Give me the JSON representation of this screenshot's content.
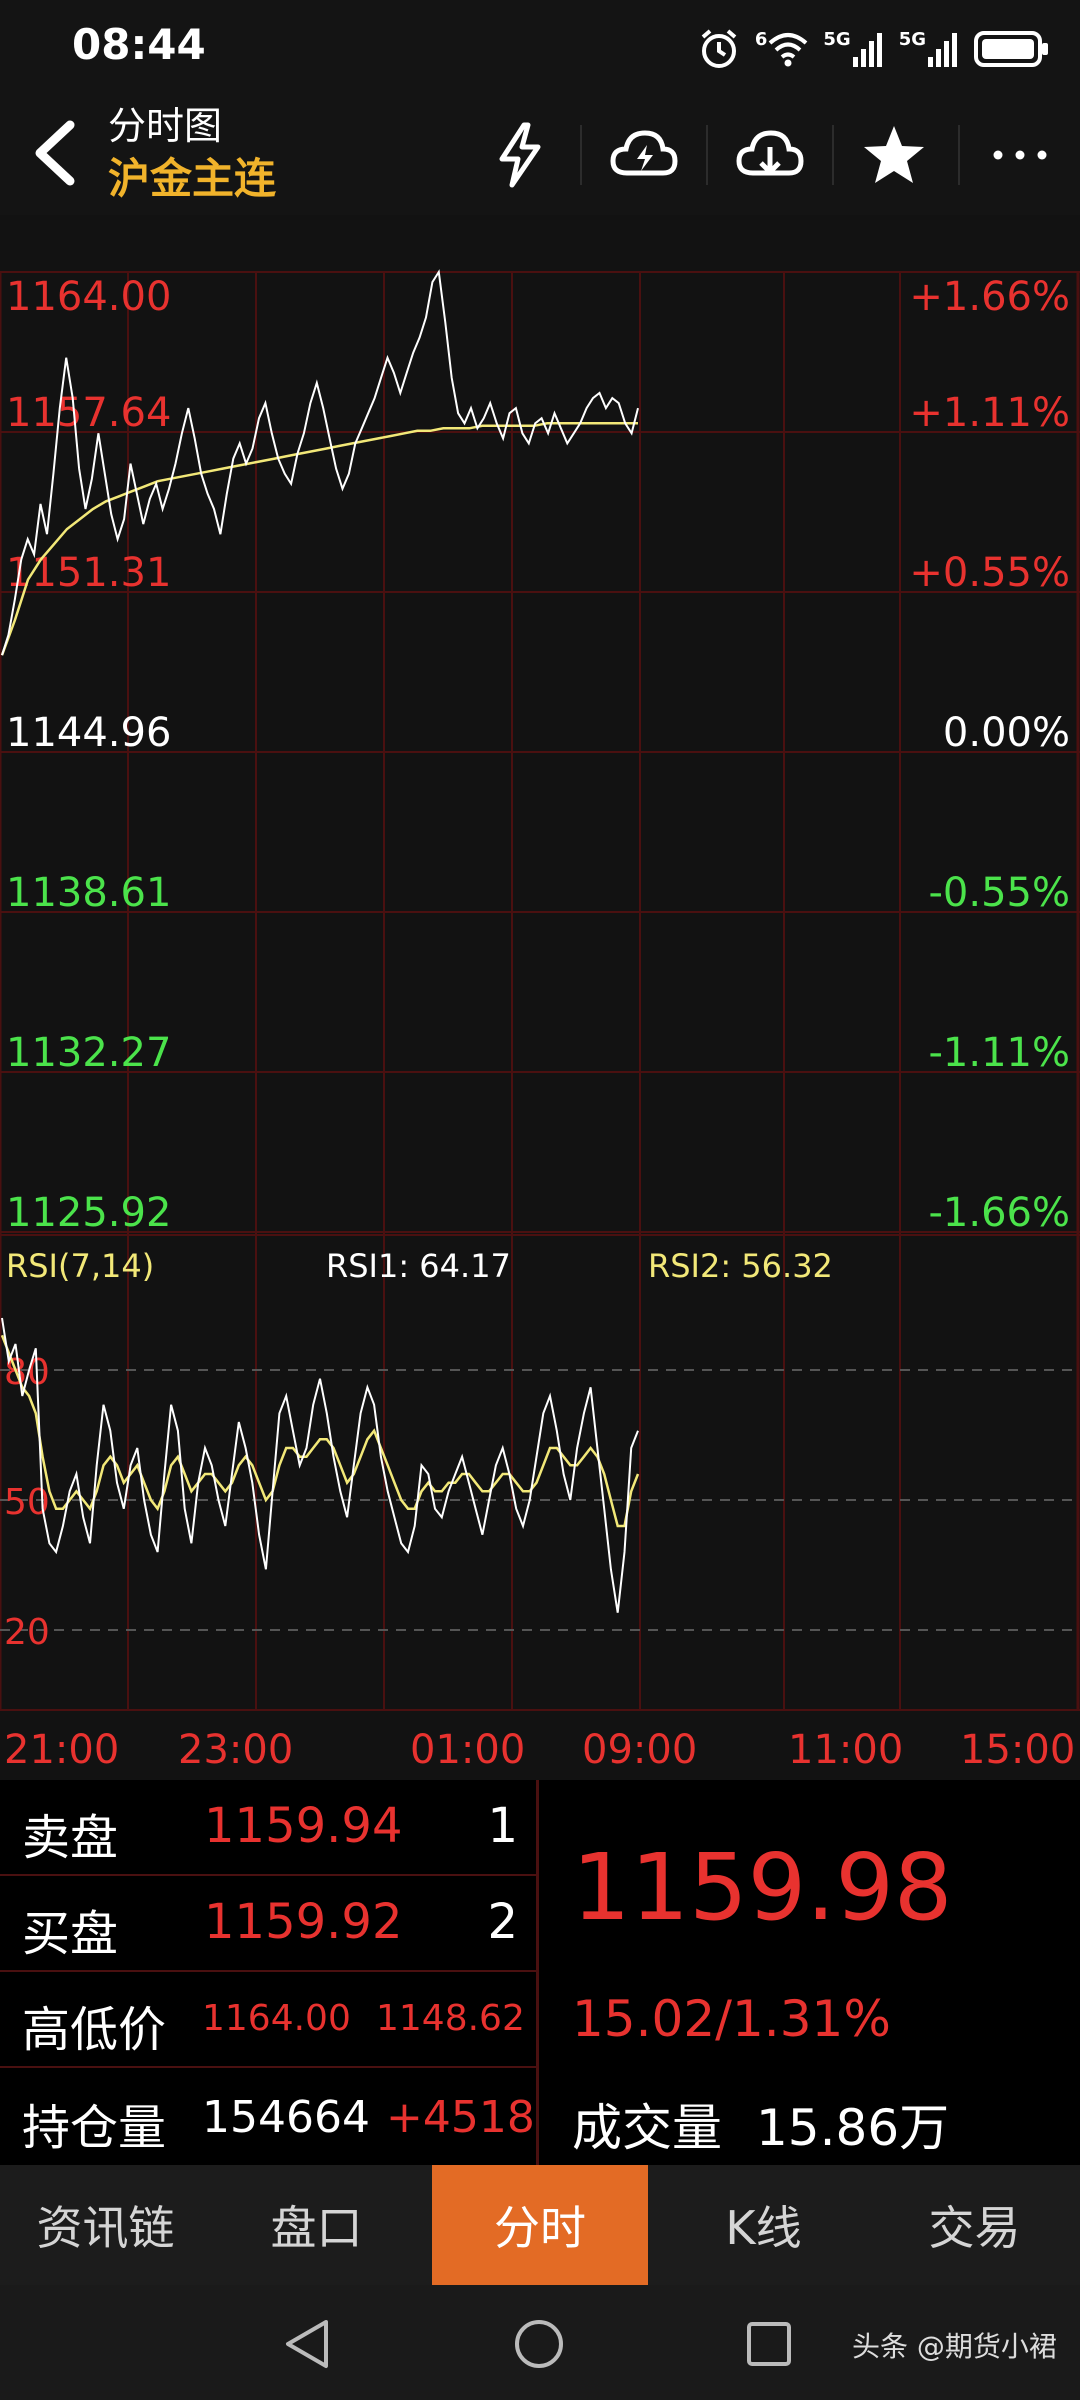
{
  "status_bar": {
    "time": "08:44",
    "net1": "5G",
    "net2": "5G",
    "wifi_sup": "6"
  },
  "header": {
    "title": "分时图",
    "subtitle": "沪金主连"
  },
  "colors": {
    "up": "#e8322f",
    "down": "#4be34b",
    "neutral": "#ffffff",
    "accent": "#f1b32b",
    "avg_line": "#f2e878",
    "active_tab": "#e36b25"
  },
  "chart_data": [
    {
      "type": "line",
      "price_axis": [
        "1164.00",
        "1157.64",
        "1151.31",
        "1144.96",
        "1138.61",
        "1132.27",
        "1125.92"
      ],
      "pct_axis": [
        "+1.66%",
        "+1.11%",
        "+0.55%",
        "0.00%",
        "-0.55%",
        "-1.11%",
        "-1.66%"
      ],
      "ylim": [
        1125.92,
        1164.0
      ],
      "series": [
        {
          "values": [
            1148.8,
            1149.6,
            1151.0,
            1152.6,
            1153.4,
            1152.8,
            1154.8,
            1153.6,
            1156.0,
            1158.6,
            1160.6,
            1159.0,
            1156.2,
            1154.6,
            1155.8,
            1157.6,
            1156.0,
            1154.4,
            1153.4,
            1154.2,
            1156.4,
            1155.2,
            1154.0,
            1155.0,
            1155.6,
            1154.6,
            1155.4,
            1156.4,
            1157.6,
            1158.6,
            1157.4,
            1156.0,
            1155.2,
            1154.6,
            1153.6,
            1155.2,
            1156.6,
            1157.2,
            1156.4,
            1157.0,
            1158.2,
            1158.8,
            1157.6,
            1156.6,
            1156.0,
            1155.6,
            1156.8,
            1157.6,
            1158.8,
            1159.6,
            1158.6,
            1157.4,
            1156.2,
            1155.4,
            1156.0,
            1157.2,
            1157.8,
            1158.4,
            1159.0,
            1159.8,
            1160.6,
            1160.0,
            1159.2,
            1160.0,
            1160.8,
            1161.4,
            1162.2,
            1163.6,
            1164.0,
            1162.0,
            1159.8,
            1158.4,
            1158.0,
            1158.6,
            1157.8,
            1158.2,
            1158.8,
            1158.0,
            1157.4,
            1158.4,
            1158.6,
            1157.6,
            1157.2,
            1158.0,
            1158.2,
            1157.6,
            1158.4,
            1157.8,
            1157.2,
            1157.6,
            1158.0,
            1158.6,
            1159.0,
            1159.2,
            1158.6,
            1159.0,
            1158.8,
            1158.0,
            1157.6,
            1158.6
          ]
        },
        {
          "values": [
            1148.8,
            1150.2,
            1151.8,
            1152.6,
            1153.2,
            1153.8,
            1154.2,
            1154.6,
            1154.9,
            1155.1,
            1155.3,
            1155.5,
            1155.7,
            1155.8,
            1155.9,
            1156.0,
            1156.1,
            1156.2,
            1156.3,
            1156.4,
            1156.5,
            1156.6,
            1156.7,
            1156.8,
            1156.9,
            1157.0,
            1157.1,
            1157.2,
            1157.3,
            1157.4,
            1157.5,
            1157.6,
            1157.7,
            1157.7,
            1157.8,
            1157.8,
            1157.8,
            1157.9,
            1157.9,
            1157.9,
            1157.9,
            1157.9,
            1158.0,
            1158.0,
            1158.0,
            1158.0,
            1158.0,
            1158.0,
            1158.0,
            1158.0
          ]
        }
      ]
    },
    {
      "type": "line",
      "title": "RSI(7,14)",
      "rsi1_label": "RSI1: 64.17",
      "rsi2_label": "RSI2: 56.32",
      "y_ticks": [
        "80",
        "50",
        "20"
      ],
      "ylim": [
        0,
        100
      ],
      "series": [
        {
          "values": [
            92,
            82,
            86,
            74,
            80,
            85,
            48,
            40,
            38,
            44,
            52,
            56,
            46,
            40,
            58,
            72,
            66,
            54,
            48,
            58,
            62,
            50,
            42,
            38,
            56,
            72,
            66,
            48,
            40,
            54,
            62,
            58,
            50,
            44,
            56,
            68,
            62,
            54,
            42,
            34,
            52,
            70,
            74,
            66,
            58,
            62,
            72,
            78,
            70,
            60,
            52,
            46,
            58,
            70,
            76,
            72,
            60,
            52,
            46,
            40,
            38,
            44,
            58,
            56,
            48,
            46,
            52,
            56,
            60,
            54,
            48,
            42,
            50,
            58,
            62,
            56,
            48,
            44,
            50,
            60,
            70,
            74,
            66,
            56,
            50,
            62,
            70,
            76,
            62,
            48,
            34,
            24,
            38,
            62,
            66
          ]
        },
        {
          "values": [
            88,
            84,
            80,
            76,
            74,
            70,
            60,
            52,
            48,
            48,
            50,
            52,
            50,
            48,
            52,
            58,
            60,
            58,
            54,
            56,
            58,
            54,
            50,
            48,
            52,
            58,
            60,
            56,
            52,
            54,
            56,
            56,
            54,
            52,
            54,
            58,
            60,
            58,
            54,
            50,
            52,
            58,
            62,
            62,
            60,
            60,
            62,
            64,
            64,
            62,
            58,
            54,
            56,
            60,
            64,
            66,
            62,
            58,
            54,
            50,
            48,
            48,
            52,
            54,
            52,
            52,
            54,
            54,
            56,
            56,
            54,
            52,
            52,
            54,
            56,
            56,
            54,
            52,
            52,
            54,
            58,
            62,
            62,
            60,
            58,
            58,
            60,
            62,
            60,
            56,
            50,
            44,
            44,
            52,
            56
          ]
        }
      ]
    }
  ],
  "time_axis": [
    "21:00",
    "23:00",
    "01:00",
    "09:00",
    "11:00",
    "15:00"
  ],
  "quote": {
    "sell_label": "卖盘",
    "sell_price": "1159.94",
    "sell_count": "1",
    "buy_label": "买盘",
    "buy_price": "1159.92",
    "buy_count": "2",
    "hl_label": "高低价",
    "high": "1164.00",
    "low": "1148.62",
    "oi_label": "持仓量",
    "oi": "154664",
    "oi_change": "+4518",
    "last_price": "1159.98",
    "change": "15.02/1.31%",
    "volume_label": "成交量",
    "volume": "15.86万"
  },
  "tabs": [
    {
      "label": "资讯链",
      "active": false
    },
    {
      "label": "盘口",
      "active": false
    },
    {
      "label": "分时",
      "active": true
    },
    {
      "label": "K线",
      "active": false
    },
    {
      "label": "交易",
      "active": false
    }
  ],
  "watermark": "头条 @期货小裙"
}
